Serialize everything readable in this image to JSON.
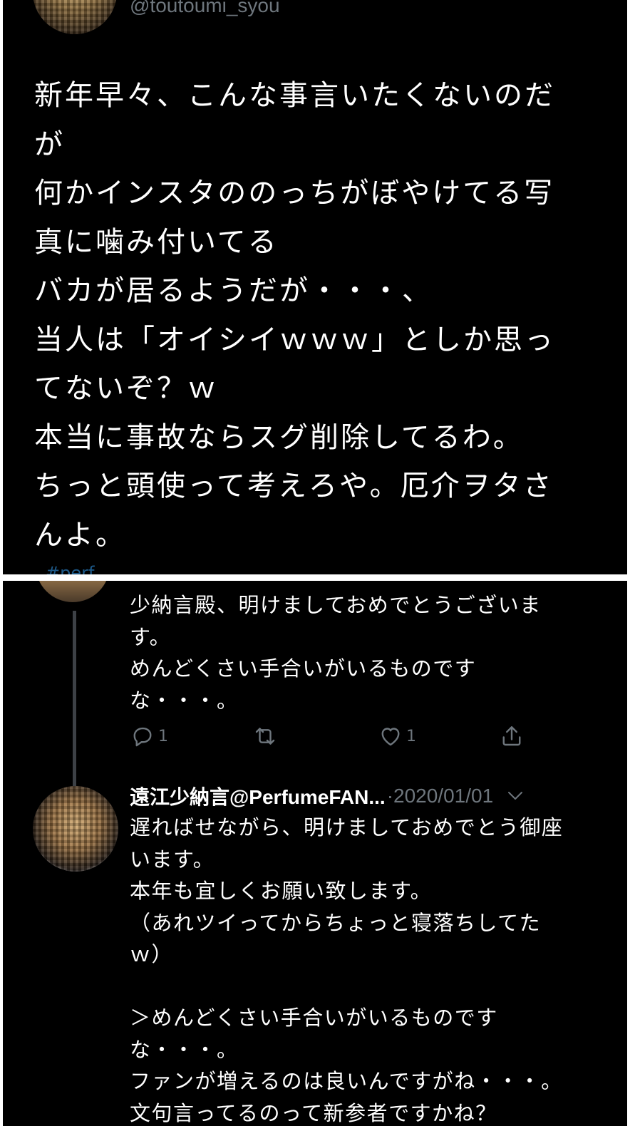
{
  "top_tweet": {
    "handle": "@toutoumi_syou",
    "text": "新年早々、こんな事言いたくないのだ\nが\n何かインスタののっちがぼやけてる写\n真に噛み付いてる\nバカが居るようだが・・・、\n当人は「オイシイｗｗｗ」としか思っ\nてないぞ？ｗ\n本当に事故ならスグ削除してるわ。\nちっと頭使って考えろや。厄介ヲタさ\nんよ。",
    "cut_link": "#perf"
  },
  "reply1": {
    "text": "少納言殿、明けましておめでとうございま\nす。\nめんどくさい手合いがいるものです\nな・・・。",
    "reply_count": "1",
    "like_count": "1"
  },
  "reply2": {
    "author": "遠江少納言@PerfumeFAN...",
    "date": "·2020/01/01",
    "text": "遅ればせながら、明けましておめでとう御座\nいます。\n本年も宜しくお願い致します。\n（あれツイってからちょっと寝落ちしてた\nｗ）\n\n＞めんどくさい手合いがいるものです\nな・・・。\nファンが増えるのは良いんですがね・・・。\n文句言ってるのって新参者ですかね？"
  },
  "icons": {
    "reply": "comment-icon",
    "retweet": "retweet-icon",
    "like": "heart-icon",
    "share": "share-icon",
    "more": "chevron-down-icon"
  },
  "colors": {
    "background": "#000000",
    "text": "#ffffff",
    "muted": "#6e767d",
    "thread_line": "#3d4146"
  }
}
